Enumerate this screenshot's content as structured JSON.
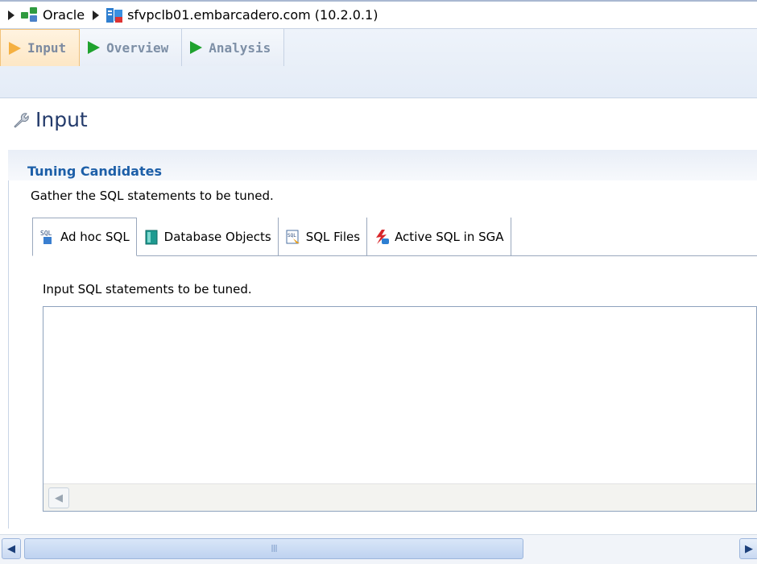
{
  "breadcrumb": {
    "items": [
      {
        "label": "Oracle",
        "icon": "database-group-icon"
      },
      {
        "label": "sfvpclb01.embarcadero.com (10.2.0.1)",
        "icon": "server-icon"
      }
    ]
  },
  "main_tabs": [
    {
      "label": "Input",
      "active": true
    },
    {
      "label": "Overview",
      "active": false
    },
    {
      "label": "Analysis",
      "active": false
    }
  ],
  "page": {
    "heading": "Input",
    "icon": "wrench-icon"
  },
  "section": {
    "title": "Tuning Candidates",
    "description": "Gather the SQL statements to be tuned."
  },
  "sub_tabs": [
    {
      "label": "Ad hoc SQL",
      "active": true,
      "icon": "sql-icon"
    },
    {
      "label": "Database Objects",
      "active": false,
      "icon": "database-icon"
    },
    {
      "label": "SQL Files",
      "active": false,
      "icon": "sql-file-icon"
    },
    {
      "label": "Active SQL in SGA",
      "active": false,
      "icon": "active-sql-icon"
    }
  ],
  "adhoc_panel": {
    "label": "Input SQL statements to be tuned.",
    "sql_text": ""
  },
  "scrollbar": {
    "thumb_grip": "III"
  },
  "colors": {
    "accent": "#1d5fa8",
    "active_tab": "#fde7c5",
    "play_green": "#1fa22e"
  }
}
